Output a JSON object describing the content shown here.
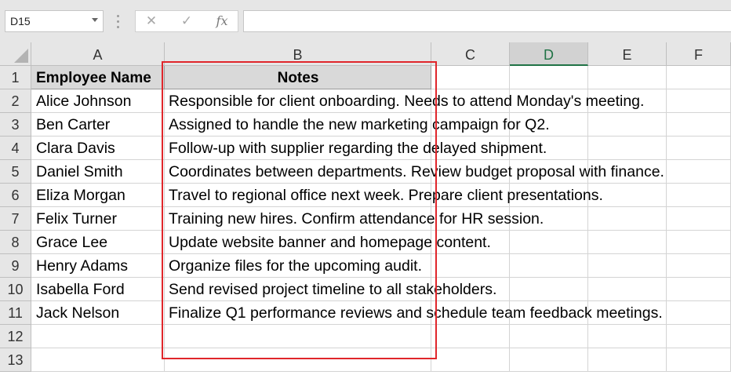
{
  "namebox": {
    "value": "D15"
  },
  "formula_bar": {
    "cancel_glyph": "✕",
    "enter_glyph": "✓",
    "fx_label": "fx",
    "value": ""
  },
  "columns": [
    "A",
    "B",
    "C",
    "D",
    "E",
    "F"
  ],
  "active_column": "D",
  "rows": [
    "1",
    "2",
    "3",
    "4",
    "5",
    "6",
    "7",
    "8",
    "9",
    "10",
    "11",
    "12",
    "13"
  ],
  "header": {
    "employee_name": "Employee Name",
    "notes": "Notes"
  },
  "records": [
    {
      "name": "Alice Johnson",
      "note": "Responsible for client onboarding. Needs to attend Monday's meeting."
    },
    {
      "name": "Ben Carter",
      "note": "Assigned to handle the new marketing campaign for Q2."
    },
    {
      "name": "Clara Davis",
      "note": "Follow-up with supplier regarding the delayed shipment."
    },
    {
      "name": "Daniel Smith",
      "note": "Coordinates between departments. Review budget proposal with finance."
    },
    {
      "name": "Eliza Morgan",
      "note": "Travel to regional office next week. Prepare client presentations."
    },
    {
      "name": "Felix Turner",
      "note": "Training new hires. Confirm attendance for HR session."
    },
    {
      "name": "Grace Lee",
      "note": "Update website banner and homepage content."
    },
    {
      "name": "Henry Adams",
      "note": "Organize files for the upcoming audit."
    },
    {
      "name": "Isabella Ford",
      "note": "Send revised project timeline to all stakeholders."
    },
    {
      "name": "Jack Nelson",
      "note": "Finalize Q1 performance reviews and schedule team feedback meetings."
    }
  ],
  "colors": {
    "highlight_box": "#e0262b",
    "active_column": "#217346"
  }
}
